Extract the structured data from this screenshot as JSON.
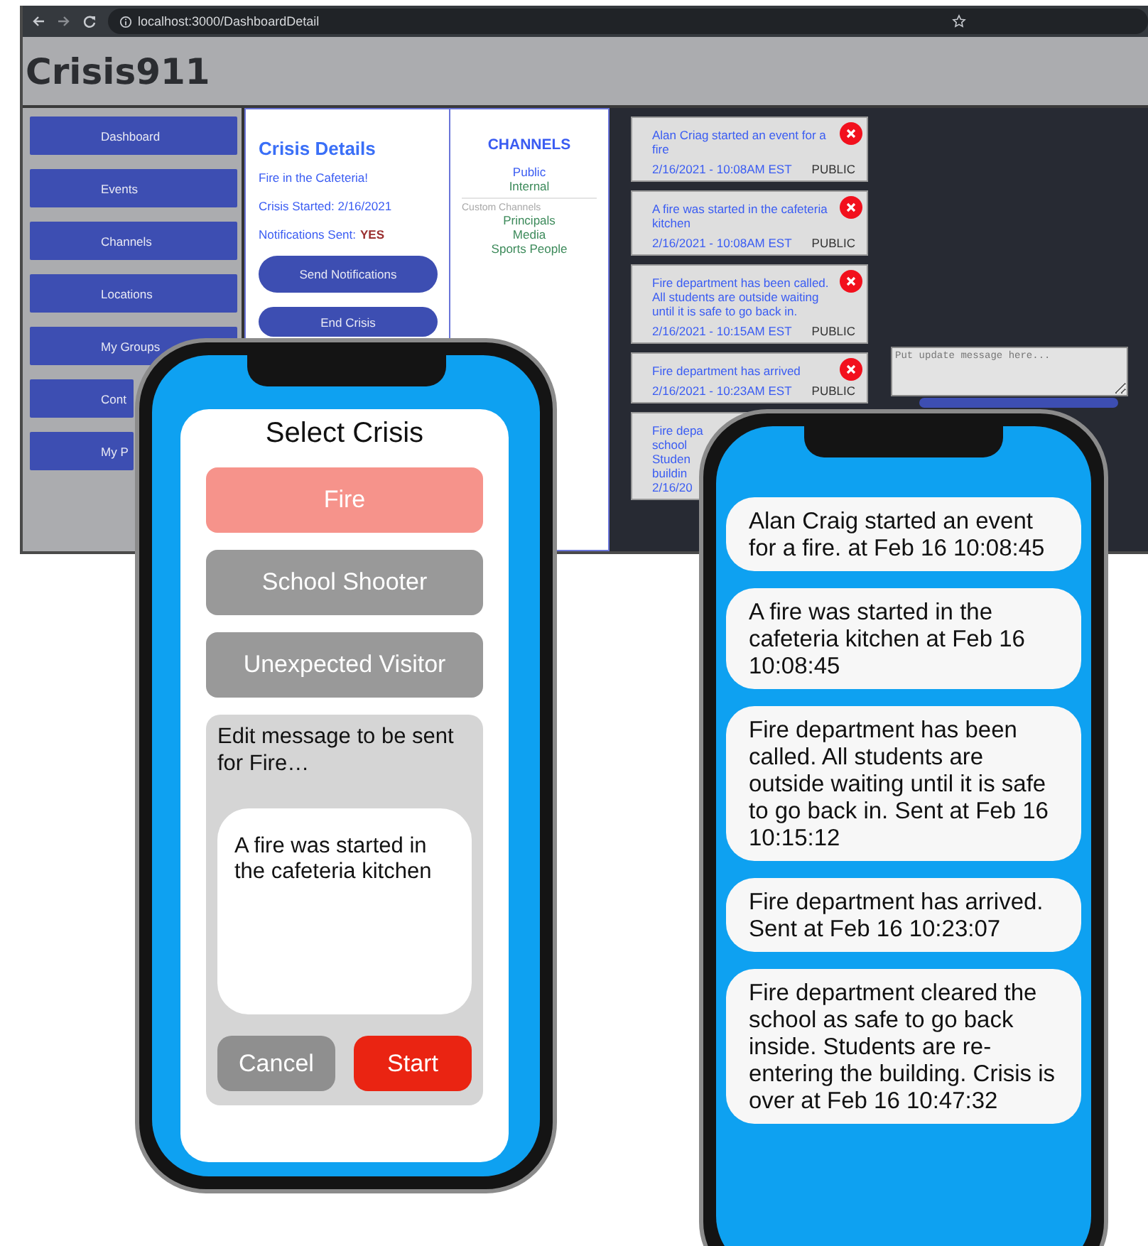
{
  "browser": {
    "url": "localhost:3000/DashboardDetail"
  },
  "app": {
    "title": "Crisis911"
  },
  "sidebar": {
    "items": [
      {
        "label": "Dashboard"
      },
      {
        "label": "Events"
      },
      {
        "label": "Channels"
      },
      {
        "label": "Locations"
      },
      {
        "label": "My Groups"
      },
      {
        "label": "Cont"
      },
      {
        "label": "My P"
      }
    ]
  },
  "crisis_details": {
    "title": "Crisis Details",
    "name": "Fire in the Cafeteria!",
    "started": "Crisis Started: 2/16/2021",
    "notifications_label": "Notifications Sent:",
    "notifications_value": "YES",
    "buttons": [
      "Send Notifications",
      "End Crisis"
    ]
  },
  "channels": {
    "title": "CHANNELS",
    "items": [
      {
        "label": "Public",
        "color": "#3a5cf2"
      },
      {
        "label": "Internal",
        "color": "#3c8a5a"
      }
    ],
    "custom_label": "Custom Channels",
    "custom": [
      "Principals",
      "Media",
      "Sports People"
    ]
  },
  "events": [
    {
      "message": "Alan Criag started an event for a fire",
      "time": "2/16/2021 - 10:08AM EST",
      "visibility": "PUBLIC",
      "dismissable": true
    },
    {
      "message": "A fire was started in the cafeteria kitchen",
      "time": "2/16/2021 - 10:08AM EST",
      "visibility": "PUBLIC",
      "dismissable": true
    },
    {
      "message": "Fire department has been called. All students are outside waiting until it is safe to go back in.",
      "time": "2/16/2021 - 10:15AM EST",
      "visibility": "PUBLIC",
      "dismissable": true
    },
    {
      "message": "Fire department has arrived",
      "time": "2/16/2021 - 10:23AM EST",
      "visibility": "PUBLIC",
      "dismissable": true
    },
    {
      "message": "Fire depa\nschool\nStuden\nbuildin",
      "time": "2/16/20",
      "dismissable": false
    }
  ],
  "update": {
    "placeholder": "Put update message here..."
  },
  "phone_crisis": {
    "title": "Select Crisis",
    "options": [
      {
        "label": "Fire",
        "selected": true
      },
      {
        "label": "School Shooter",
        "selected": false
      },
      {
        "label": "Unexpected Visitor",
        "selected": false
      }
    ],
    "edit_label": "Edit message to be sent for Fire…",
    "message": "A fire was started in the cafeteria kitchen",
    "buttons": [
      {
        "label": "Cancel",
        "kind": "cancel"
      },
      {
        "label": "Start",
        "kind": "start"
      }
    ]
  },
  "phone_messages": {
    "messages": [
      "Alan Craig started an event for a fire. at Feb 16 10:08:45",
      "A fire was started in the cafeteria kitchen at Feb 16 10:08:45",
      "Fire department has been called. All students are outside waiting until it is safe to go back in. Sent at Feb 16 10:15:12",
      "Fire department has arrived. Sent at Feb 16 10:23:07",
      "Fire department cleared the school as safe to go back inside. Students are re-entering the building. Crisis is over at Feb 16 10:47:32"
    ]
  }
}
